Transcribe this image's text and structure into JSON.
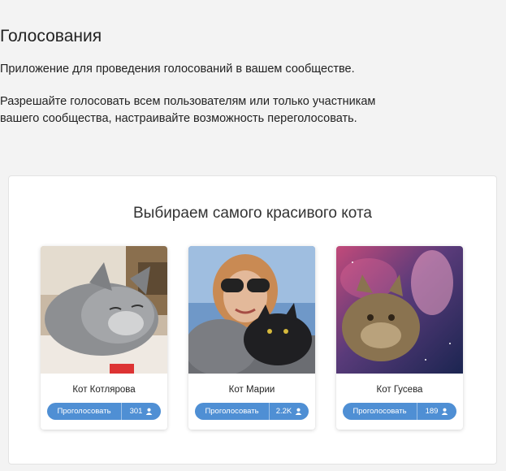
{
  "header": {
    "title": "Голосования",
    "subtitle": "Приложение для проведения голосований в вашем сообществе.",
    "description_line1": "Разрешайте голосовать всем пользователям или только участникам",
    "description_line2": "вашего сообщества, настраивайте возможность переголосовать."
  },
  "poll": {
    "title": "Выбираем самого красивого кота",
    "accent_color": "#4f8fd4",
    "candidates": [
      {
        "name": "Кот Котлярова",
        "vote_label": "Проголосовать",
        "votes": "301",
        "icon": "user-icon"
      },
      {
        "name": "Кот Марии",
        "vote_label": "Проголосовать",
        "votes": "2.2K",
        "icon": "user-icon"
      },
      {
        "name": "Кот Гусева",
        "vote_label": "Проголосовать",
        "votes": "189",
        "icon": "user-icon"
      }
    ]
  }
}
